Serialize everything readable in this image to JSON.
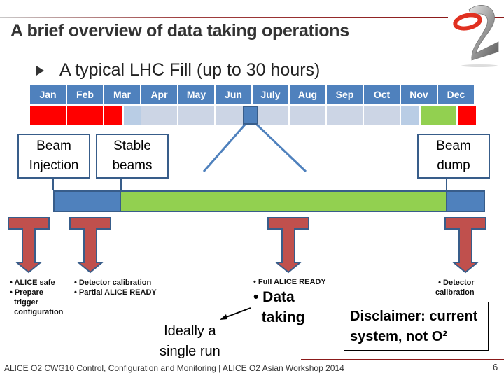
{
  "slide": {
    "title": "A brief overview of data taking operations",
    "subtitle": "A typical LHC Fill (up to 30 hours)",
    "logo": "alice-o2-logo-icon"
  },
  "timeline": {
    "months": [
      "Jan",
      "Feb",
      "Mar",
      "Apr",
      "May",
      "Jun",
      "July",
      "Aug",
      "Sep",
      "Oct",
      "Nov",
      "Dec"
    ],
    "colors": {
      "header": "#4f81bd",
      "shutdown": "#ff0000",
      "operation": "#ccd5e5",
      "transition": "#b9cde5",
      "ion": "#92d050",
      "zoom_fill": "#4f81bd"
    },
    "cells": [
      {
        "month": "Jan",
        "status": "shutdown"
      },
      {
        "month": "Feb",
        "status": "shutdown"
      },
      {
        "month": "Mar",
        "status": "shutdown",
        "fraction": 0.5
      },
      {
        "month": "Mar",
        "status": "transition",
        "fraction": 0.5
      },
      {
        "month": "Apr",
        "status": "operation"
      },
      {
        "month": "May",
        "status": "operation"
      },
      {
        "month": "Jun",
        "status": "operation"
      },
      {
        "month": "July",
        "status": "operation"
      },
      {
        "month": "Aug",
        "status": "operation"
      },
      {
        "month": "Sep",
        "status": "operation"
      },
      {
        "month": "Oct",
        "status": "operation"
      },
      {
        "month": "Nov",
        "status": "transition",
        "fraction": 0.5
      },
      {
        "month": "Nov",
        "status": "ion",
        "fraction": 0.5
      },
      {
        "month": "Dec",
        "status": "ion",
        "fraction": 0.5
      },
      {
        "month": "Dec",
        "status": "shutdown",
        "fraction": 0.5
      }
    ],
    "highlighted_fill_month": "Jun/July boundary"
  },
  "phases": {
    "beam_injection": "Beam\nInjection",
    "stable_beams": "Stable\nbeams",
    "beam_dump": "Beam\ndump",
    "bar_colors": {
      "injection": "#4f81bd",
      "stable": "#92d050",
      "dump": "#4f81bd"
    }
  },
  "notes": {
    "a": [
      "• ALICE safe",
      "• Prepare",
      "  trigger",
      "  configuration"
    ],
    "b": [
      "• Detector calibration",
      "• Partial ALICE READY"
    ],
    "c": [
      "• Full ALICE READY"
    ],
    "data_taking": "• Data\n  taking",
    "ideally": "Ideally a\nsingle run",
    "d": [
      "• Detector",
      "calibration"
    ],
    "disclaimer": "Disclaimer: current\nsystem, not O²"
  },
  "footer": {
    "text": "ALICE O2 CWG10 Control, Configuration and Monitoring | ALICE O2 Asian Workshop 2014",
    "page": "6"
  }
}
